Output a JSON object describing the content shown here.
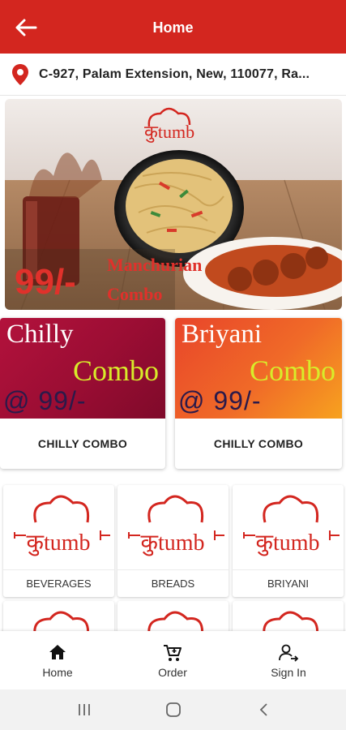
{
  "header": {
    "title": "Home",
    "back_icon": "arrow-left-icon",
    "color": "#d3261f"
  },
  "address": {
    "icon": "location-pin-icon",
    "text": "C-927, Palam Extension, New, 110077, Ra..."
  },
  "banner": {
    "brand": "कुtumb",
    "price": "99/-",
    "line1": "Manchurian",
    "line2": "Combo"
  },
  "combos": [
    {
      "art_line1": "Chilly",
      "art_line2": "Combo",
      "art_price": "@ 99/-",
      "caption": "CHILLY COMBO"
    },
    {
      "art_line1": "Briyani",
      "art_line2": "Combo",
      "art_price": "@ 99/-",
      "caption": "CHILLY COMBO"
    }
  ],
  "categories": [
    {
      "label": "BEVERAGES"
    },
    {
      "label": "BREADS"
    },
    {
      "label": "BRIYANI"
    },
    {
      "label": ""
    },
    {
      "label": ""
    },
    {
      "label": ""
    }
  ],
  "brand_logo_text": "कुtumb",
  "bottom_nav": [
    {
      "label": "Home",
      "icon": "home-icon"
    },
    {
      "label": "Order",
      "icon": "cart-plus-icon"
    },
    {
      "label": "Sign In",
      "icon": "person-signin-icon"
    }
  ],
  "system_nav": [
    "recents-icon",
    "home-circle-icon",
    "back-chevron-icon"
  ]
}
